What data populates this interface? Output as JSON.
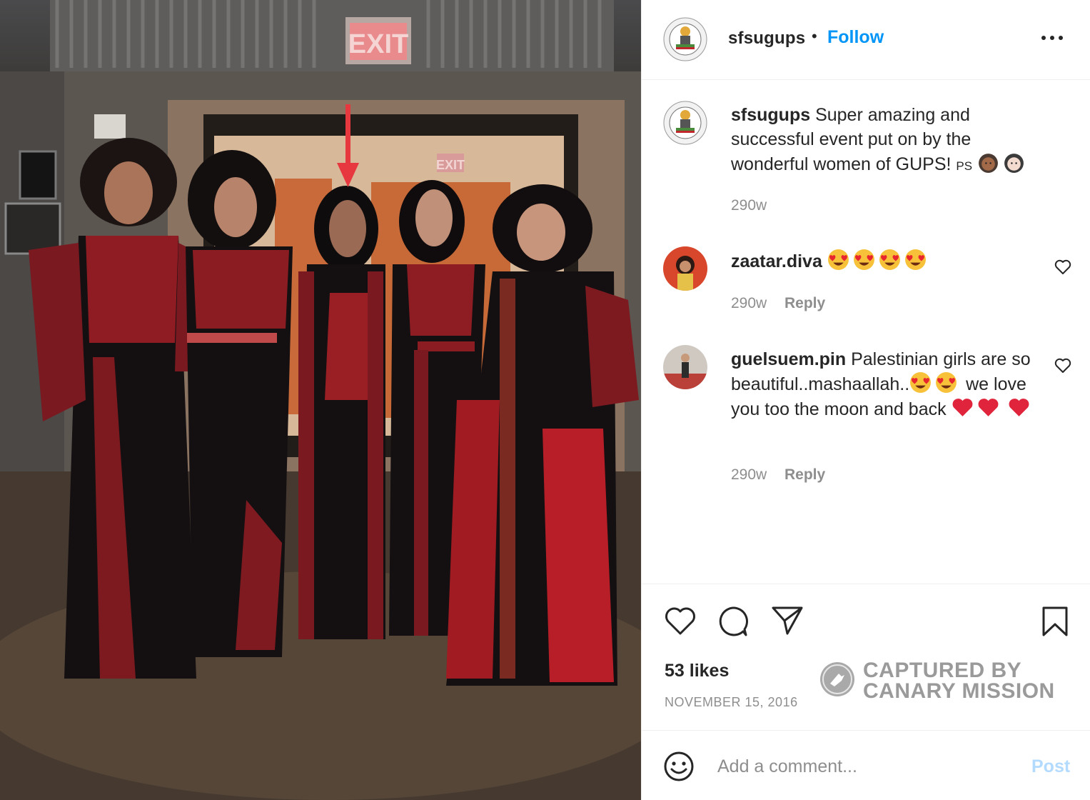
{
  "post": {
    "username": "sfsugups",
    "follow_label": "Follow",
    "dot": "•",
    "more_icon": "more-horizontal-icon",
    "photo": {
      "exit_sign_text": "EXIT",
      "exit_sign_text_rear": "EXIT",
      "annotation": "red arrow pointing down",
      "colors": {
        "dress_red": "#8e1c22",
        "dress_black": "#141012",
        "exit_red": "#e85b5f",
        "arrow": "#e8383f"
      }
    }
  },
  "caption": {
    "username": "sfsugups",
    "text": "Super amazing and successful event put on by the wonderful women of GUPS! ",
    "suffix": "PS",
    "emojis": [
      "woman-with-headscarf-medium-dark-skin-emoji",
      "woman-with-headscarf-light-skin-emoji"
    ],
    "time": "290w"
  },
  "comments": [
    {
      "username": "zaatar.diva",
      "text": "",
      "emojis": [
        "heart-eyes-emoji",
        "heart-eyes-emoji",
        "heart-eyes-emoji",
        "heart-eyes-emoji"
      ],
      "time": "290w",
      "reply_label": "Reply"
    },
    {
      "username": "guelsuem.pin",
      "text_1": "Palestinian girls are so beautiful..mashaallah..",
      "text_2": "we love you too the moon and back",
      "time": "290w",
      "reply_label": "Reply"
    }
  ],
  "actions": {
    "like_icon": "heart-icon",
    "comment_icon": "comment-icon",
    "share_icon": "paper-plane-icon",
    "save_icon": "bookmark-icon",
    "likes": "53 likes",
    "date": "NOVEMBER 15, 2016"
  },
  "watermark": {
    "line1": "CAPTURED BY",
    "line2": "CANARY MISSION",
    "color": "#9a9a9a"
  },
  "add_comment": {
    "placeholder": "Add a comment...",
    "post_label": "Post",
    "emoji_icon": "smiley-icon"
  },
  "colors": {
    "link_blue": "#0095f6",
    "post_disabled": "#b3dbff",
    "text": "#262626",
    "muted": "#8e8e8e"
  }
}
